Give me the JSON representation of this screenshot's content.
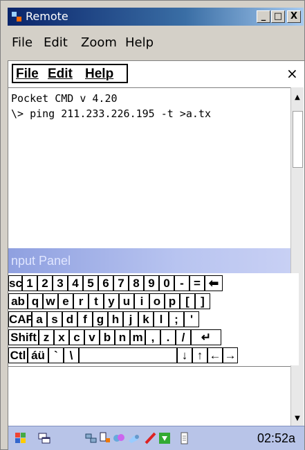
{
  "window": {
    "title": "Remote",
    "controls": {
      "minimize": "_",
      "maximize": "□",
      "close": "X"
    },
    "menu": [
      "File",
      "Edit",
      "Zoom",
      "Help"
    ]
  },
  "device_menu": {
    "items": [
      "File",
      "Edit",
      "Help"
    ],
    "close": "×"
  },
  "console": {
    "lines": [
      "Pocket CMD v 4.20",
      "\\> ping 211.233.226.195 -t >a.tx"
    ]
  },
  "input_panel": {
    "title": "nput Panel"
  },
  "keyboard": {
    "row1": [
      "sc",
      "1",
      "2",
      "3",
      "4",
      "5",
      "6",
      "7",
      "8",
      "9",
      "0",
      "-",
      "=",
      "⬅"
    ],
    "row2": [
      "ab",
      "q",
      "w",
      "e",
      "r",
      "t",
      "y",
      "u",
      "i",
      "o",
      "p",
      "[",
      "]"
    ],
    "row3": [
      "CAP",
      "a",
      "s",
      "d",
      "f",
      "g",
      "h",
      "j",
      "k",
      "l",
      ";",
      "'"
    ],
    "row4": [
      "Shift",
      "z",
      "x",
      "c",
      "v",
      "b",
      "n",
      "m",
      ",",
      ".",
      "/",
      "↵"
    ],
    "row5": [
      "Ctl",
      "áü",
      "`",
      "\\",
      "",
      "↓",
      "↑",
      "←",
      "→"
    ]
  },
  "taskbar": {
    "icons": [
      "start-flag-icon",
      "windows-icon",
      "network-icon",
      "sync-icon",
      "connection-icon",
      "paint-icon",
      "download-icon",
      "battery-icon"
    ],
    "time": "02:52a"
  }
}
